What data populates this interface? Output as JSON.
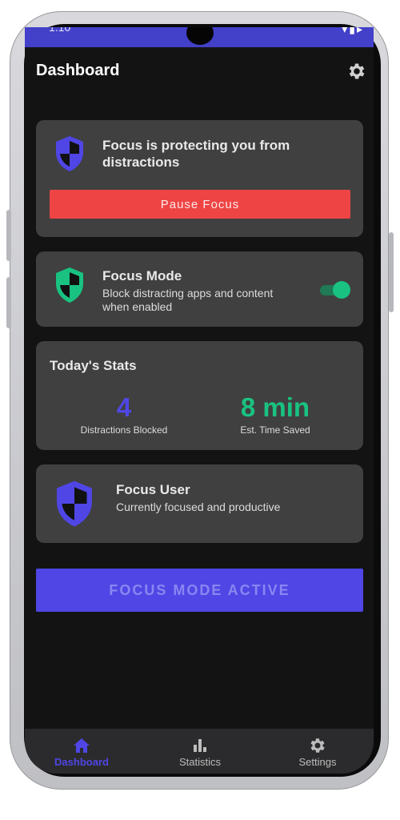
{
  "status_bar": {
    "time": "1:10",
    "icons": "▾▮▸"
  },
  "header": {
    "title": "Dashboard",
    "settings_icon": "gear-icon"
  },
  "protection_card": {
    "title": "Focus is protecting you from distractions",
    "icon": "shield-icon",
    "button_label": "Pause Focus"
  },
  "focus_mode_card": {
    "title": "Focus Mode",
    "description": "Block distracting apps and content when enabled",
    "icon": "shield-icon",
    "toggle_on": true
  },
  "stats_card": {
    "title": "Today's Stats",
    "stats": [
      {
        "value": "4",
        "label": "Distractions Blocked"
      },
      {
        "value": "8 min",
        "label": "Est. Time Saved"
      }
    ]
  },
  "user_card": {
    "name": "Focus User",
    "status": "Currently focused and productive",
    "icon": "shield-icon"
  },
  "primary_action": {
    "label": "FOCUS MODE ACTIVE"
  },
  "bottom_nav": {
    "items": [
      {
        "label": "Dashboard",
        "icon": "home-icon",
        "active": true
      },
      {
        "label": "Statistics",
        "icon": "bar-chart-icon",
        "active": false
      },
      {
        "label": "Settings",
        "icon": "gear-icon",
        "active": false
      }
    ]
  },
  "colors": {
    "accent": "#4f46e5",
    "green": "#19c281",
    "danger": "#ef4444",
    "card_bg": "#404040",
    "screen_bg": "#131313"
  }
}
